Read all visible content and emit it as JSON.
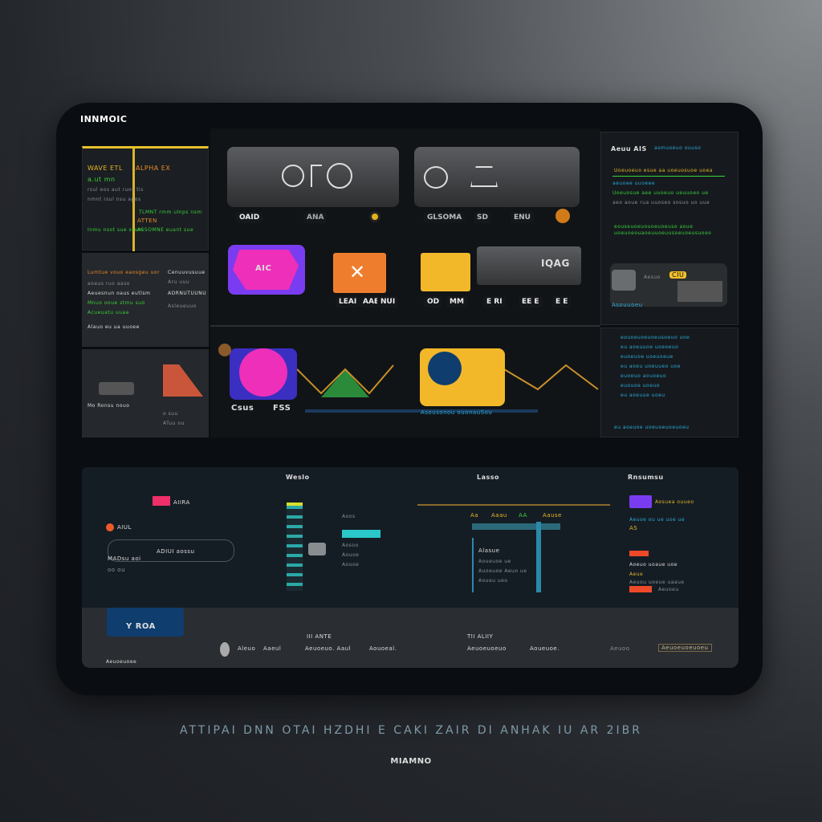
{
  "app": {
    "title": "INNMOIC"
  },
  "left": {
    "panel1": {
      "col1_head": "WAVE ETL",
      "col2_head": "ALPHA EX",
      "lines": [
        "a.ut mn",
        "rsul eos aut ruos tis",
        "nmnt rsul nsu apos",
        "TLMNT rmm ulnps nsm",
        "ATTEN",
        "Inmu nsot sue ssum",
        "ASSOMNE euant sue"
      ]
    },
    "panel2": {
      "head": "Lumtue vouo eaosgeu uor",
      "lines": [
        "aoeus ruo aaso",
        "Aeuesnun oaus eutlsm",
        "Mnuo ooue stmu suo",
        "Acueuatu uuaa",
        "Alauo eu ua uuoee"
      ],
      "side": [
        "Cenuuvusuue",
        "Aru uuu",
        "ADRNUTUUNU",
        "Asleueuuo"
      ]
    },
    "panel3": {
      "lines": [
        "Mo Ronsu nouo",
        "o suu",
        "ATuu ou"
      ]
    }
  },
  "cards": {
    "c1": {
      "buttons": [
        "OAID",
        "ANA"
      ]
    },
    "c2": {
      "buttons": [
        "GLSOMA",
        "SD",
        "ENU"
      ]
    },
    "magenta": {
      "label": "AIC"
    },
    "orange": {
      "buttons": [
        "LEAI",
        "AAE",
        "NUI"
      ]
    },
    "yellow": {
      "buttons": [
        "OD",
        "MM"
      ]
    },
    "gray": {
      "label": "IQAG",
      "buttons": [
        "E RI",
        "EE E",
        "E E"
      ]
    },
    "chart_labels": [
      "Csus",
      "FSS"
    ],
    "chart_caption": "Asousonou  ouonauSou"
  },
  "right": {
    "panel1": {
      "title": "Aeuu AIS",
      "sub": "asmuoeuo ouuso",
      "lines": [
        "Uoeuoeuo esue aa uoeuosuoe uoea",
        "aeuoee uuoeee",
        "Uoeuosue aee uuoeuo ueuuoeo ue",
        "aeo aoue rua uuoseo sosuo uo uue"
      ],
      "green": [
        "eouseuoeuouoeuoeuso aoue",
        "uoeuoeouaoeuuoeuusoeuoeusuoeo"
      ]
    },
    "widget": {
      "label": "Aesuo",
      "btn": "CIU",
      "caption": "Asouuoeu"
    },
    "panel3": {
      "lines": [
        "eouoeuoeuoeusoeuo uoe",
        "eu aoeuuoe uoeoeuo",
        "euoeuoe  uoeuoeue",
        "eu aoeu uoeuueo uoe",
        "euoeuo aouoeuo",
        "euouoe uoeuo",
        "eu aoeuue uoeu",
        "eu aoeuoe uoeuoeuoeuoeu"
      ]
    }
  },
  "bottom": {
    "headers": [
      "Weslo",
      "Lasso",
      "Rnsumsu"
    ],
    "left": {
      "tag": "AIIRA",
      "tag2": "AIUL",
      "rows": [
        "ADIUI aossu",
        "MADsu aoi",
        "oo ou"
      ]
    },
    "mid_list": [
      "Aoos",
      "Aosoo",
      "Aouoe",
      "Aouoe"
    ],
    "timeline": [
      "Aa",
      "Aaau",
      "AA",
      "Aause"
    ],
    "tree": [
      "Alasue",
      "Aoueuoe ue",
      "Auoeuoe Aeuo ue",
      "Aoueu ueo"
    ],
    "right": {
      "rows": [
        "Aosuea ouueo",
        "Aeuoe ou ue uoe ue",
        "AS",
        "Aoeuo uoaue uoe",
        "Aeue",
        "Aeuou uoeue uaaue",
        "Aeuoeu"
      ]
    },
    "footer": {
      "badge": "Y ROA",
      "group1_title": "III ANTE",
      "group1": [
        "Aleuo",
        "Aaeul",
        "Aeuoeuo. Aaul",
        "Aouoeal."
      ],
      "group2_title": "TII ALIIY",
      "group2": [
        "Aeuoeuoeuo",
        "Aoueuoe."
      ],
      "right_label": "Aeuoo",
      "right_button": "Aeuoeuoeuoeu",
      "corner": "Aeuoeuoee"
    }
  },
  "caption": "ATTIPAI  DNN  OTAI  HZDHI  E  CAKI  ZAIR  DI  ANHAK  IU  AR  2IBR",
  "logo": "MIAMNO",
  "colors": {
    "yellow": "#f2b82a",
    "magenta": "#ee2fb9",
    "purple": "#7a3cf0",
    "orange": "#ee7e2d",
    "green": "#3ad13a",
    "cyan": "#2aa9d8"
  }
}
